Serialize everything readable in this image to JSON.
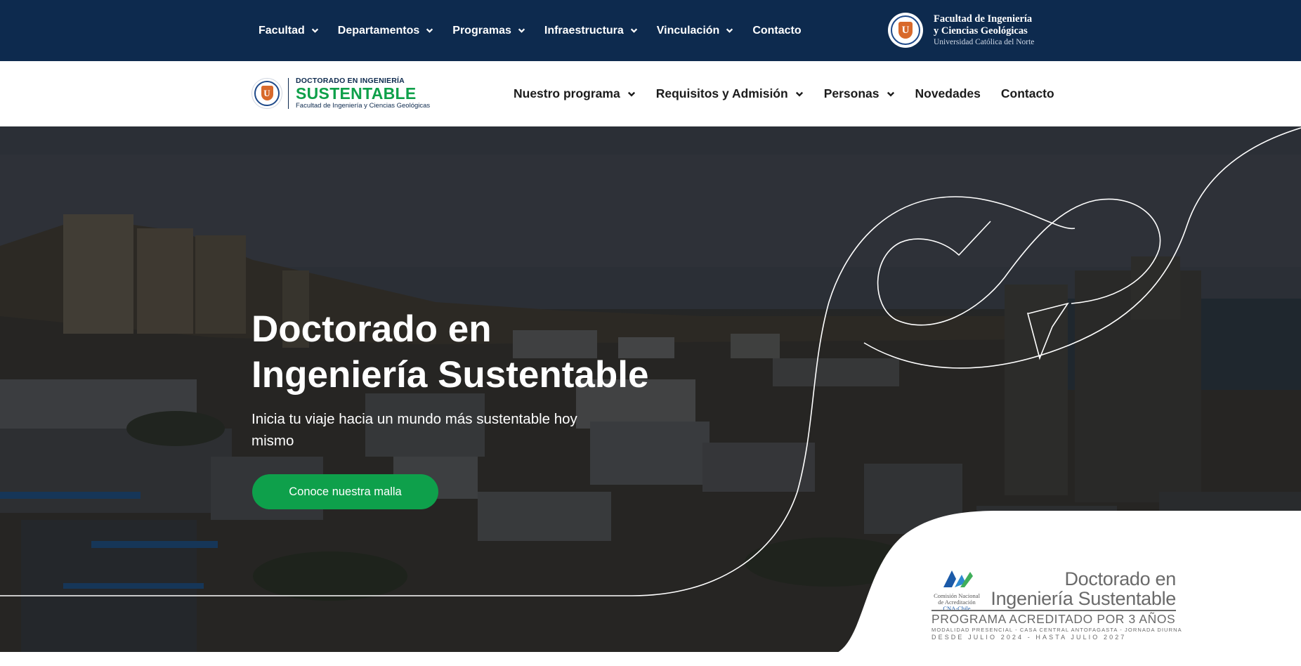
{
  "topbar": {
    "nav": [
      {
        "label": "Facultad",
        "has_dropdown": true
      },
      {
        "label": "Departamentos",
        "has_dropdown": true
      },
      {
        "label": "Programas",
        "has_dropdown": true
      },
      {
        "label": "Infraestructura",
        "has_dropdown": true
      },
      {
        "label": "Vinculación",
        "has_dropdown": true
      },
      {
        "label": "Contacto",
        "has_dropdown": false
      }
    ],
    "faculty": {
      "line1": "Facultad de Ingeniería",
      "line2": "y Ciencias Geológicas",
      "line3": "Universidad Católica del Norte",
      "seal_letter": "U"
    },
    "background": "#0d2a4e"
  },
  "mainbar": {
    "logo": {
      "line1": "DOCTORADO EN INGENIERÍA",
      "line2": "SUSTENTABLE",
      "line3": "Facultad de Ingeniería y Ciencias Geológicas",
      "seal_letter": "U"
    },
    "nav": [
      {
        "label": "Nuestro programa",
        "has_dropdown": true
      },
      {
        "label": "Requisitos y Admisión",
        "has_dropdown": true
      },
      {
        "label": "Personas",
        "has_dropdown": true
      },
      {
        "label": "Novedades",
        "has_dropdown": false
      },
      {
        "label": "Contacto",
        "has_dropdown": false
      }
    ]
  },
  "hero": {
    "title_line1": "Doctorado en",
    "title_line2": "Ingeniería Sustentable",
    "subtitle": "Inicia tu viaje hacia un mundo más sustentable hoy mismo",
    "cta_label": "Conoce nuestra malla",
    "accent_color": "#0ea04b"
  },
  "accreditation": {
    "cna_label": "Comisión Nacional de Acreditación",
    "cna_short": "CNA-Chile",
    "title_line1": "Doctorado en",
    "title_line2": "Ingeniería Sustentable",
    "line1": "PROGRAMA ACREDITADO POR 3 AÑOS",
    "line2": "MODALIDAD PRESENCIAL - CASA CENTRAL ANTOFAGASTA - JORNADA DIURNA",
    "line3": "DESDE JULIO 2024 - HASTA JULIO 2027"
  },
  "icons": {
    "dropdown": "chevron-down-icon",
    "seal": "university-seal-icon",
    "cna": "cna-logo-icon",
    "hero_graphic": "program-swoosh-icon"
  }
}
